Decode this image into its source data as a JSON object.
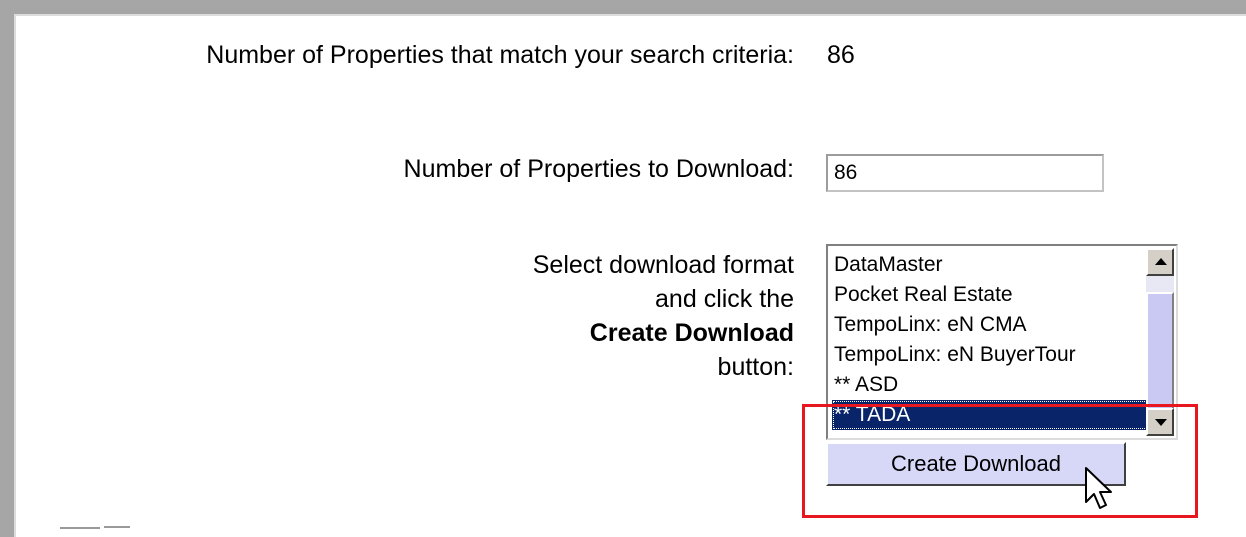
{
  "search": {
    "match_label": "Number of Properties that match your search criteria:",
    "match_count": "86"
  },
  "download": {
    "count_label": "Number of Properties to Download:",
    "count_value": "86",
    "instructions": {
      "line1": "Select download format",
      "line2": "and click the",
      "line3": "Create Download",
      "line4": "button:"
    },
    "formats": [
      "DataMaster",
      "Pocket Real Estate",
      "TempoLinx: eN CMA",
      "TempoLinx: eN BuyerTour",
      "** ASD",
      "** TADA"
    ],
    "selected_format": "** TADA",
    "create_button_label": "Create Download"
  },
  "colors": {
    "selection_background": "#0a246a",
    "button_background": "#d7d7f7",
    "highlight_border": "#e8161e"
  },
  "icons": {
    "cursor": "mouse-pointer-icon",
    "scroll_up": "scroll-up-arrow-icon",
    "scroll_down": "scroll-down-arrow-icon"
  }
}
